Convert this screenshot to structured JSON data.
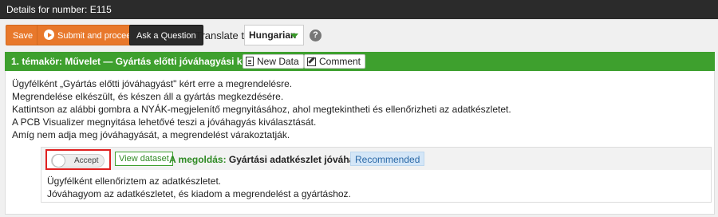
{
  "window": {
    "title": "Details for number: E115"
  },
  "toolbar": {
    "save_label": "Save",
    "submit_label": "Submit and proceed",
    "ask_label": "Ask a Question",
    "translate_label": "Translate to",
    "language_selected": "Hungarian",
    "help_symbol": "?"
  },
  "topic": {
    "title": "1. témakör: Művelet — Gyártás előtti jóváhagyási kérelem",
    "new_data_label": "New Data",
    "comment_label": "Comment",
    "description": [
      "Ügyfélként „Gyártás előtti jóváhagyást\" kért erre a megrendelésre.",
      "Megrendelése elkészült, és készen áll a gyártás megkezdésére.",
      "Kattintson az alábbi gombra a NYÁK-megjelenítő megnyitásához, ahol megtekintheti és ellenőrizheti az adatkészletet.",
      "A PCB Visualizer megnyitása lehetővé teszi a jóváhagyás kiválasztását.",
      "Amíg nem adja meg jóváhagyását, a megrendelést várakoztatják."
    ],
    "option": {
      "toggle_label": "Accept",
      "view_dataset_label": "View dataset",
      "solution_prefix": "A megoldás:",
      "solution_text": "Gyártási adatkészlet jóváhagyása",
      "badge": "Recommended",
      "description": [
        "Ügyfélként ellenőriztem az adatkészletet.",
        "Jóváhagyom az adatkészletet, és kiadom a megrendelést a gyártáshoz."
      ]
    }
  },
  "colors": {
    "accent_orange": "#e8782b",
    "header_green": "#3ea02e",
    "dark": "#2b2b2b",
    "highlight_red": "#e02020",
    "badge_blue": "#d4e6f7"
  },
  "icons": {
    "submit": "play-circle-icon",
    "language_dropdown": "chevron-down-icon",
    "help": "help-icon",
    "new_data": "document-icon",
    "comment": "edit-icon"
  }
}
